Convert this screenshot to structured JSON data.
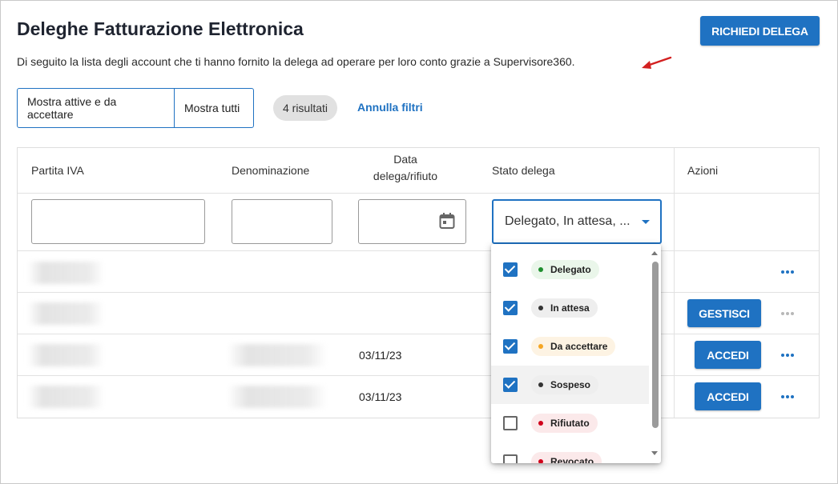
{
  "page": {
    "title": "Deleghe Fatturazione Elettronica",
    "subtitle": "Di seguito la lista degli account che ti hanno fornito la delega ad operare per loro conto grazie a Supervisore360.",
    "request_button": "RICHIEDI DELEGA"
  },
  "filters": {
    "toggle_active": "Mostra attive e da accettare",
    "toggle_all": "Mostra tutti",
    "results": "4 risultati",
    "clear": "Annulla filtri"
  },
  "table": {
    "headers": {
      "vat": "Partita IVA",
      "name": "Denominazione",
      "date_line1": "Data",
      "date_line2": "delega/rifiuto",
      "status": "Stato delega",
      "actions": "Azioni"
    },
    "status_filter_value": "Delegato, In attesa, ...",
    "rows": [
      {
        "date": ""
      },
      {
        "date": "",
        "action": "GESTISCI"
      },
      {
        "date": "03/11/23",
        "action": "ACCEDI"
      },
      {
        "date": "03/11/23",
        "action": "ACCEDI"
      }
    ]
  },
  "status_options": [
    {
      "label": "Delegato",
      "checked": true,
      "dot": "#1e8e2e",
      "bg": "#eaf6ea"
    },
    {
      "label": "In attesa",
      "checked": true,
      "dot": "#333333",
      "bg": "#eeeeee"
    },
    {
      "label": "Da accettare",
      "checked": true,
      "dot": "#f5a623",
      "bg": "#fdf3e3"
    },
    {
      "label": "Sospeso",
      "checked": true,
      "dot": "#333333",
      "bg": "#eeeeee"
    },
    {
      "label": "Rifiutato",
      "checked": false,
      "dot": "#d0021b",
      "bg": "#fbe9ea"
    },
    {
      "label": "Revocato",
      "checked": false,
      "dot": "#d0021b",
      "bg": "#fbe9ea"
    }
  ],
  "colors": {
    "primary": "#1f72c2",
    "annotation_arrow": "#d32020"
  },
  "icons": {
    "calendar": "calendar-icon",
    "more": "more-horizontal-icon",
    "caret": "caret-down-icon",
    "annotation": "red-arrow-icon"
  }
}
